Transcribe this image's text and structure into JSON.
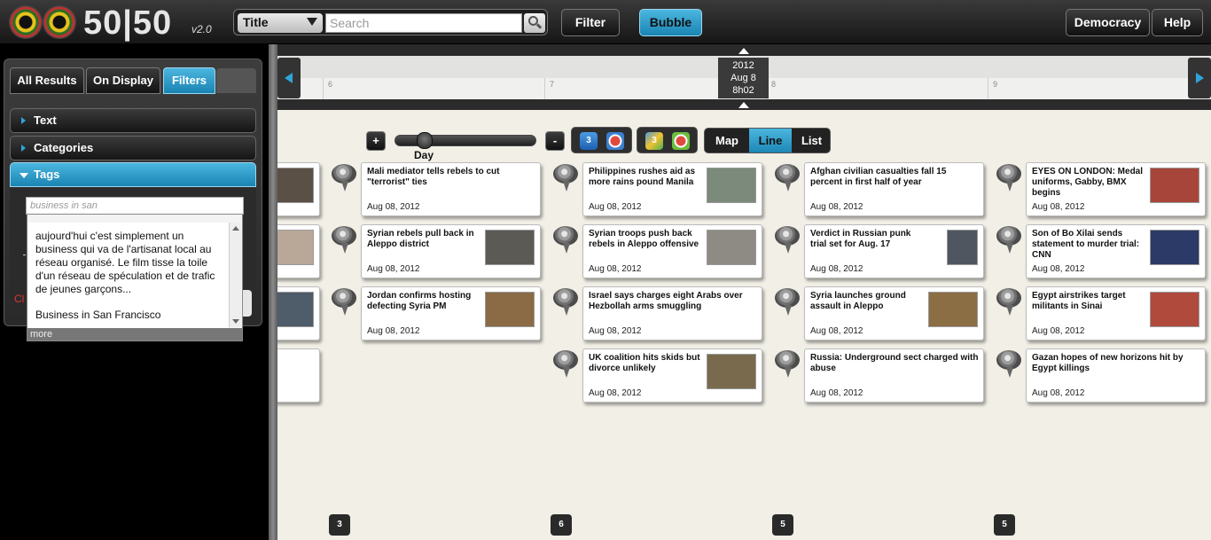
{
  "app": {
    "logo_text": "50|50",
    "version": "v2.0"
  },
  "search": {
    "type_selected": "Title",
    "placeholder": "Search"
  },
  "toolbar": {
    "filter": "Filter",
    "bubble": "Bubble",
    "democracy": "Democracy",
    "help": "Help"
  },
  "timeline": {
    "marker": {
      "year": "2012",
      "date": "Aug 8",
      "time": "8h02"
    },
    "ticks": [
      "6",
      "7",
      "8",
      "9"
    ]
  },
  "controls": {
    "zoom_label": "Day",
    "zoom_in": "+",
    "zoom_out": "-",
    "view_modes": [
      "Map",
      "Line",
      "List"
    ],
    "active_view": "Line",
    "app_icons": [
      "3",
      "3"
    ]
  },
  "left_panel": {
    "tabs": [
      "All Results",
      "On Display",
      "Filters"
    ],
    "active_tab": "Filters",
    "sections": [
      "Text",
      "Categories",
      "Tags"
    ],
    "active_section": "Tags",
    "tag_input_value": "business in san",
    "suggestions": [
      "aujourd'hui c'est simplement un business qui va de l'artisanat local au réseau organisé. Le film tisse la toile d'un réseau de spéculation et de trafic de jeunes garçons...",
      "Business in San Francisco"
    ],
    "more": "more",
    "clear_hint": "Cl"
  },
  "news": [
    {
      "title": "Mali mediator tells rebels to cut \"terrorist\" ties",
      "date": "Aug 08, 2012",
      "thumb": false
    },
    {
      "title": "Syrian rebels pull back in Aleppo district",
      "date": "Aug 08, 2012",
      "thumb": true,
      "thumb_color": "#5c5a55"
    },
    {
      "title": "Jordan confirms hosting defecting Syria PM",
      "date": "Aug 08, 2012",
      "thumb": true,
      "thumb_color": "#8a6b45"
    },
    {
      "title": "Philippines rushes aid as more rains pound Manila",
      "date": "Aug 08, 2012",
      "thumb": true,
      "thumb_color": "#7b8a7a"
    },
    {
      "title": "Syrian troops push back rebels in Aleppo offensive",
      "date": "Aug 08, 2012",
      "thumb": true,
      "thumb_color": "#8d8b84"
    },
    {
      "title": "Israel says charges eight Arabs over Hezbollah arms smuggling",
      "date": "Aug 08, 2012",
      "thumb": false
    },
    {
      "title": "UK coalition hits skids but divorce unlikely",
      "date": "Aug 08, 2012",
      "thumb": true,
      "thumb_color": "#7a6a4d"
    },
    {
      "title": "Afghan civilian casualties fall 15 percent in first half of year",
      "date": "Aug 08, 2012",
      "thumb": false
    },
    {
      "title": "Verdict in Russian punk trial set for Aug. 17",
      "date": "Aug 08, 2012",
      "thumb": true,
      "thumb_color": "#4f5660"
    },
    {
      "title": "Syria launches ground assault in Aleppo",
      "date": "Aug 08, 2012",
      "thumb": true,
      "thumb_color": "#8c6e44"
    },
    {
      "title": "Russia: Underground sect charged with abuse",
      "date": "Aug 08, 2012",
      "thumb": false
    },
    {
      "title": "EYES ON LONDON: Medal uniforms, Gabby, BMX begins",
      "date": "Aug 08, 2012",
      "thumb": true,
      "thumb_color": "#a8453a"
    },
    {
      "title": "Son of Bo Xilai sends statement to murder trial: CNN",
      "date": "Aug 08, 2012",
      "thumb": true,
      "thumb_color": "#2b3a66"
    },
    {
      "title": "Egypt airstrikes target militants in Sinai",
      "date": "Aug 08, 2012",
      "thumb": true,
      "thumb_color": "#b04a3c"
    },
    {
      "title": "Gazan hopes of new horizons hit by Egypt killings",
      "date": "Aug 08, 2012",
      "thumb": false
    }
  ],
  "column_counts": [
    "3",
    "6",
    "5",
    "5"
  ],
  "colors": {
    "accent": "#2fa4da",
    "topbar": "#222222",
    "background": "#f1efe6"
  }
}
